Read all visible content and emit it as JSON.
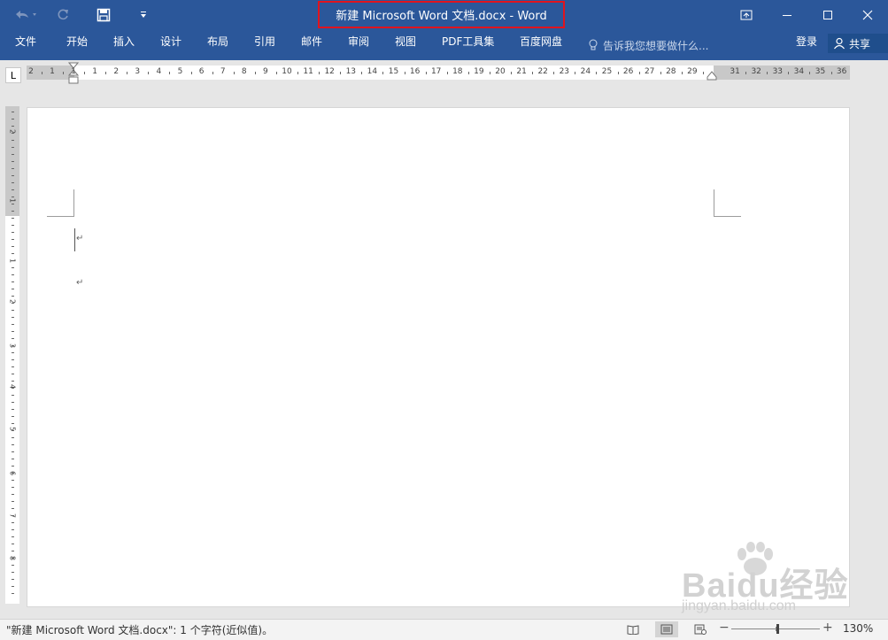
{
  "window": {
    "title": "新建 Microsoft Word 文档.docx - Word",
    "accent_color": "#2b579a",
    "highlight_color": "#e0141e"
  },
  "quick_access": {
    "undo_icon": "undo-icon",
    "redo_icon": "redo-icon",
    "save_icon": "save-icon",
    "customize_icon": "customize-qat-icon"
  },
  "ribbon": {
    "tabs": [
      "文件",
      "开始",
      "插入",
      "设计",
      "布局",
      "引用",
      "邮件",
      "审阅",
      "视图",
      "PDF工具集",
      "百度网盘"
    ],
    "tell_me_placeholder": "告诉我您想要做什么...",
    "sign_in": "登录",
    "share": "共享"
  },
  "ruler": {
    "horizontal_numbers": [
      "2",
      "1",
      "1",
      "1",
      "2",
      "3",
      "4",
      "5",
      "6",
      "7",
      "8",
      "9",
      "10",
      "11",
      "12",
      "13",
      "14",
      "15",
      "16",
      "17",
      "18",
      "19",
      "20",
      "21",
      "22",
      "23",
      "24",
      "25",
      "26",
      "27",
      "28",
      "29",
      "31",
      "32",
      "33",
      "34",
      "35",
      "36"
    ],
    "vertical_numbers": [
      "2",
      "1",
      "1",
      "2",
      "3",
      "4",
      "5",
      "6",
      "7",
      "8"
    ],
    "tab_selector": "L"
  },
  "document": {
    "paragraph_mark": "↵"
  },
  "status": {
    "text": "\"新建 Microsoft Word 文档.docx\": 1 个字符(近似值)。",
    "zoom_out": "−",
    "zoom_in": "+",
    "zoom_level": "130%"
  },
  "watermark": {
    "logo": "Baidu经验",
    "url": "jingyan.baidu.com"
  }
}
